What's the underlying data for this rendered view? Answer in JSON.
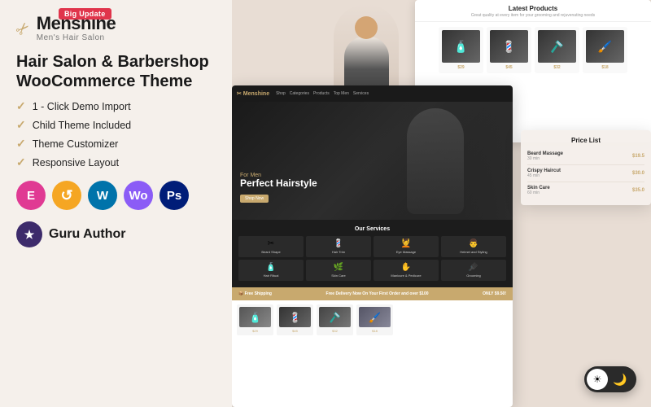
{
  "badge": {
    "label": "Big Update"
  },
  "logo": {
    "title": "Menshine",
    "subtitle": "Men's Hair Salon"
  },
  "theme": {
    "title_line1": "Hair Salon & Barbershop",
    "title_line2": "WooCommerce Theme"
  },
  "features": [
    {
      "id": "click-demo",
      "text": "1 - Click Demo Import"
    },
    {
      "id": "child-theme",
      "text": "Child Theme Included"
    },
    {
      "id": "customizer",
      "text": "Theme Customizer"
    },
    {
      "id": "responsive",
      "text": "Responsive Layout"
    }
  ],
  "tech_icons": [
    {
      "id": "elementor",
      "label": "E",
      "title": "Elementor"
    },
    {
      "id": "update",
      "label": "↺",
      "title": "Updates"
    },
    {
      "id": "wordpress",
      "label": "W",
      "title": "WordPress"
    },
    {
      "id": "woocommerce",
      "label": "Wo",
      "title": "WooCommerce"
    },
    {
      "id": "photoshop",
      "label": "Ps",
      "title": "Photoshop"
    }
  ],
  "author": {
    "label": "Guru Author",
    "icon": "★"
  },
  "preview": {
    "shop_title": "Latest Products",
    "shop_subtitle": "Great quality at every item for your grooming and rejuvenating needs",
    "products": [
      {
        "emoji": "🧴",
        "price": "$29"
      },
      {
        "emoji": "✂️",
        "price": "$45"
      },
      {
        "emoji": "🪒",
        "price": "$32"
      },
      {
        "emoji": "🖌️",
        "price": "$18"
      }
    ],
    "hero_for_men": "For Men",
    "hero_perfect": "Perfect Hairstyle",
    "hero_btn": "Shop Now",
    "services_title": "Our Services",
    "services": [
      {
        "icon": "✂",
        "name": "Beard Shape"
      },
      {
        "icon": "💈",
        "name": "Hair Trim"
      },
      {
        "icon": "🪒",
        "name": "Eye Massage"
      },
      {
        "icon": "👨",
        "name": "Helmet and Styling"
      },
      {
        "icon": "🧴",
        "name": "Hair Ritual"
      },
      {
        "icon": "💆",
        "name": "Skin Care"
      },
      {
        "icon": "✂",
        "name": "Manicure & Pedicure"
      },
      {
        "icon": "🌿",
        "name": "Grooming"
      }
    ],
    "shipping_text": "Free Shipping",
    "price_list_title": "Price List",
    "price_items": [
      {
        "name": "Beard Massage",
        "desc": "30 min",
        "price": "$19.5"
      },
      {
        "name": "Crispy Haircut",
        "desc": "45 min",
        "price": "$30.0"
      },
      {
        "name": "Skin Care",
        "desc": "60 min",
        "price": "$35.0"
      }
    ]
  },
  "dark_toggle": {
    "light_icon": "☀",
    "dark_icon": "🌙"
  }
}
